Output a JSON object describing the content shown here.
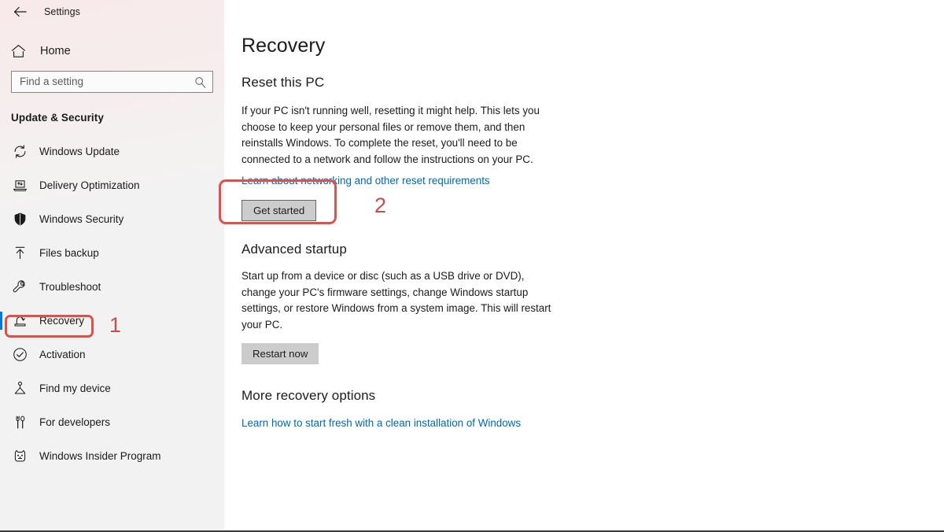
{
  "window": {
    "app_title": "Settings",
    "back_icon": "back-arrow-icon"
  },
  "sidebar": {
    "home": {
      "label": "Home",
      "icon": "home-icon"
    },
    "search": {
      "placeholder": "Find a setting",
      "value": "",
      "icon": "search-icon"
    },
    "group_title": "Update & Security",
    "items": [
      {
        "label": "Windows Update",
        "icon": "sync-icon",
        "selected": false
      },
      {
        "label": "Delivery Optimization",
        "icon": "delivery-icon",
        "selected": false
      },
      {
        "label": "Windows Security",
        "icon": "shield-icon",
        "selected": false
      },
      {
        "label": "Files backup",
        "icon": "upload-icon",
        "selected": false
      },
      {
        "label": "Troubleshoot",
        "icon": "wrench-icon",
        "selected": false
      },
      {
        "label": "Recovery",
        "icon": "recovery-icon",
        "selected": true
      },
      {
        "label": "Activation",
        "icon": "check-circle-icon",
        "selected": false
      },
      {
        "label": "Find my device",
        "icon": "find-device-icon",
        "selected": false
      },
      {
        "label": "For developers",
        "icon": "tools-icon",
        "selected": false
      },
      {
        "label": "Windows Insider Program",
        "icon": "insider-bug-icon",
        "selected": false
      }
    ]
  },
  "main": {
    "page_title": "Recovery",
    "reset": {
      "heading": "Reset this PC",
      "description": "If your PC isn't running well, resetting it might help. This lets you choose to keep your personal files or remove them, and then reinstalls Windows. To complete the reset, you'll need to be connected to a network and follow the instructions on your PC.",
      "link": "Learn about networking and other reset requirements",
      "button": "Get started"
    },
    "advanced": {
      "heading": "Advanced startup",
      "description": "Start up from a device or disc (such as a USB drive or DVD), change your PC's firmware settings, change Windows startup settings, or restore Windows from a system image. This will restart your PC.",
      "button": "Restart now"
    },
    "more": {
      "heading": "More recovery options",
      "link": "Learn how to start fresh with a clean installation of Windows"
    }
  },
  "annotations": {
    "step1": "1",
    "step2": "2",
    "color": "#c0504d",
    "box_color": "#d9534f"
  }
}
